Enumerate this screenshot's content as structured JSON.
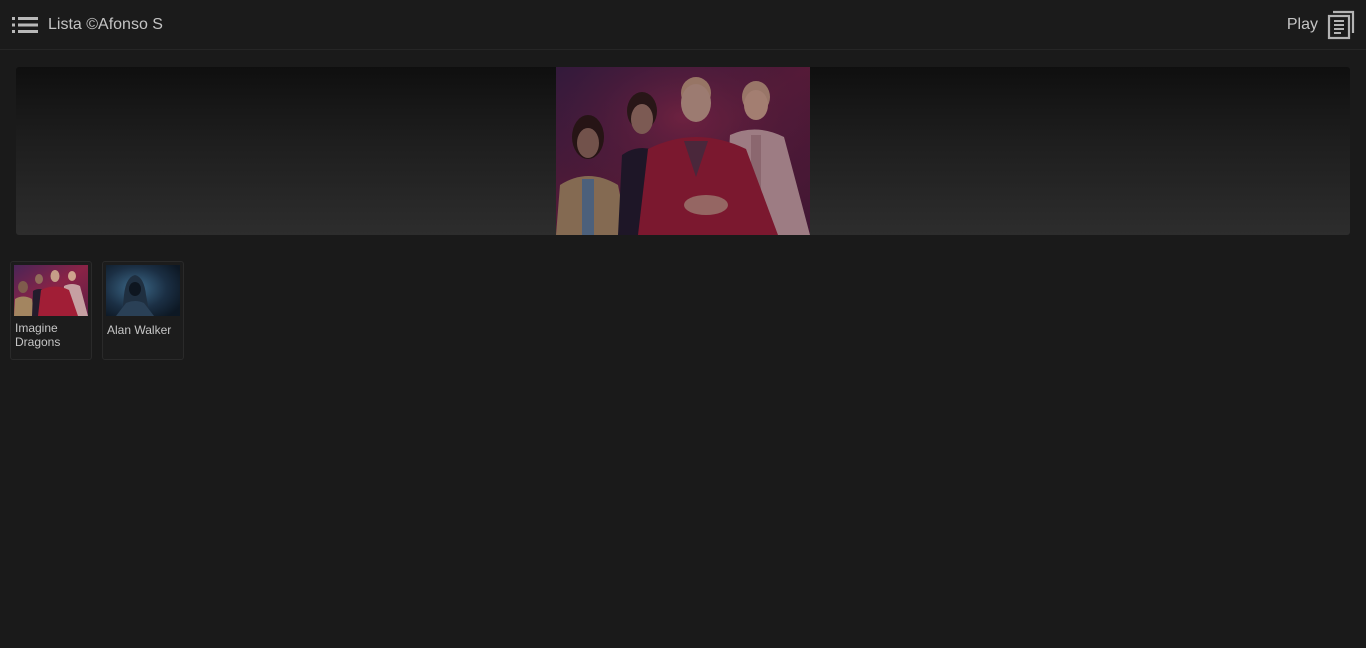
{
  "header": {
    "title": "Lista ©Afonso S",
    "play_label": "Play",
    "menu_icon": "list-menu-icon",
    "playlist_icon": "playlist-document-icon"
  },
  "banner": {
    "image": "band-photo"
  },
  "artists": [
    {
      "name": "Imagine Dragons",
      "thumb": "band-photo"
    },
    {
      "name": "Alan Walker",
      "thumb": "hooded-figure-photo"
    }
  ],
  "colors": {
    "background": "#1a1a1a",
    "topbar": "#1b1b1b",
    "text": "#c4c4c4"
  }
}
